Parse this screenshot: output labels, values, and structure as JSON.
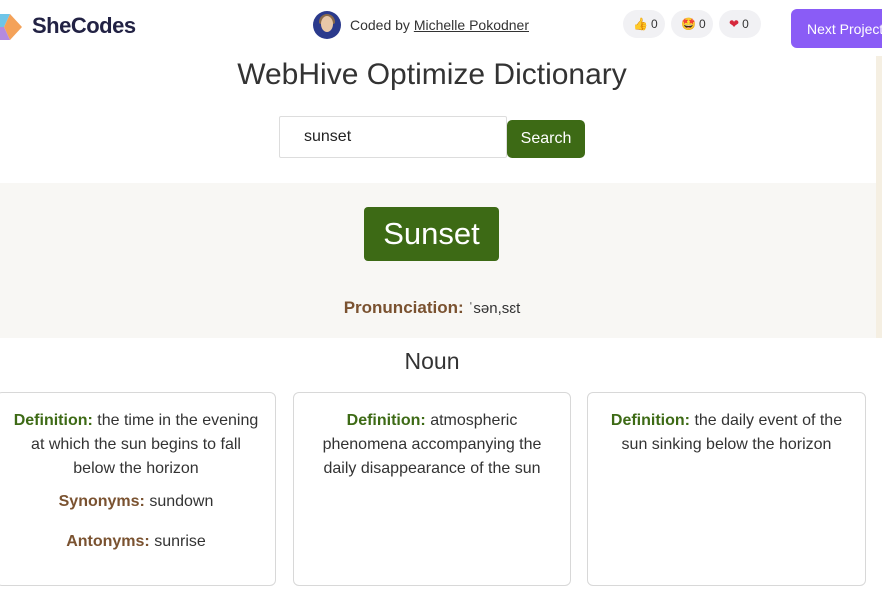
{
  "header": {
    "brand": "SheCodes",
    "credit_prefix": "Coded by",
    "credit_author": "Michelle Pokodner",
    "reactions": [
      {
        "icon": "thumbs-up-icon",
        "count": "0"
      },
      {
        "icon": "star-struck-icon",
        "count": "0"
      },
      {
        "icon": "heart-icon",
        "count": "0"
      }
    ],
    "next_button": "Next Project"
  },
  "page": {
    "title": "WebHive Optimize Dictionary"
  },
  "search": {
    "value": "sunset",
    "button_label": "Search"
  },
  "result": {
    "word": "Sunset",
    "pronunciation_label": "Pronunciation:",
    "pronunciation": "ˈsən,sɛt",
    "part_of_speech": "Noun",
    "definition_label": "Definition:",
    "synonyms_label": "Synonyms:",
    "antonyms_label": "Antonyms:",
    "meanings": [
      {
        "definition": "the time in the evening at which the sun begins to fall below the horizon",
        "synonyms": "sundown",
        "antonyms": "sunrise"
      },
      {
        "definition": "atmospheric phenomena accompanying the daily disappearance of the sun"
      },
      {
        "definition": "the daily event of the sun sinking below the horizon"
      }
    ]
  },
  "colors": {
    "accent_green": "#3d6a15",
    "label_brown": "#7a5230",
    "next_button_purple": "#8a5cf6"
  }
}
